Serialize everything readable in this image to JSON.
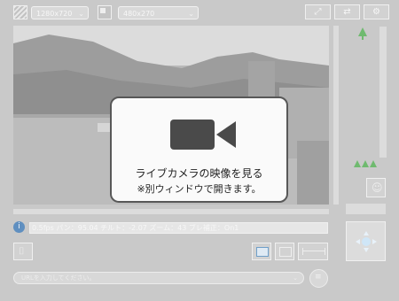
{
  "toolbar": {
    "resolution": "1280x720",
    "view_size": "480x270"
  },
  "live": {
    "title": "ライブカメラの映像を見る",
    "note": "※別ウィンドウで開きます。"
  },
  "status": "0.5fps パン：95.04 チルト：-2.07 ズーム：43 ブレ補正：On1",
  "url_hint": "URLを入力してください。",
  "colors": {
    "overlay_border": "#585858",
    "camera_icon": "#4a4a4a",
    "info_icon": "#5f8fc0",
    "tree_icon": "#6fba6f"
  }
}
